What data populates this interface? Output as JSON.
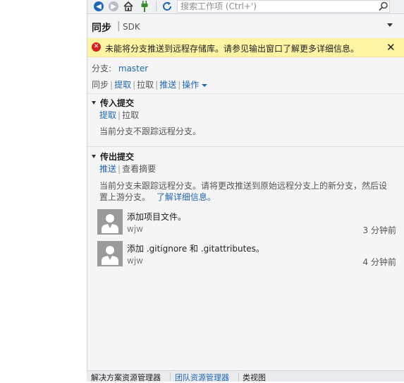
{
  "toolbar": {
    "search_placeholder": "搜索工作项 (Ctrl+')"
  },
  "header": {
    "title": "同步",
    "separator": "|",
    "subtitle": "SDK"
  },
  "error": {
    "message": "未能将分支推送到远程存储库。请参见输出窗口了解更多详细信息。",
    "close": "✕"
  },
  "branch": {
    "label": "分支:",
    "name": "master"
  },
  "actions": {
    "sync": "同步",
    "fetch": "提取",
    "pull": "拉取",
    "push": "推送",
    "operations": "操作"
  },
  "incoming": {
    "title": "传入提交",
    "fetch": "提取",
    "pull": "拉取",
    "message": "当前分支不跟踪远程分支。"
  },
  "outgoing": {
    "title": "传出提交",
    "push": "推送",
    "view_summary": "查看摘要",
    "message_line1": "当前分支未跟踪远程分支。请将更改推送到原始远程分支上的新分支，然后设",
    "message_line2": "置上游分支。",
    "learn_more": "了解详细信息。",
    "commits": [
      {
        "message": "添加项目文件。",
        "author": "wjw",
        "time": "3 分钟前"
      },
      {
        "message": "添加 .gitignore 和 .gitattributes。",
        "author": "wjw",
        "time": "4 分钟前"
      }
    ]
  },
  "bottom_tabs": {
    "tab1": "解决方案资源管理器",
    "tab2": "团队资源管理器",
    "tab3": "类视图"
  },
  "colors": {
    "accent": "#1f66b4",
    "error_bg": "#fdf5a4",
    "error_icon": "#d1231e"
  }
}
